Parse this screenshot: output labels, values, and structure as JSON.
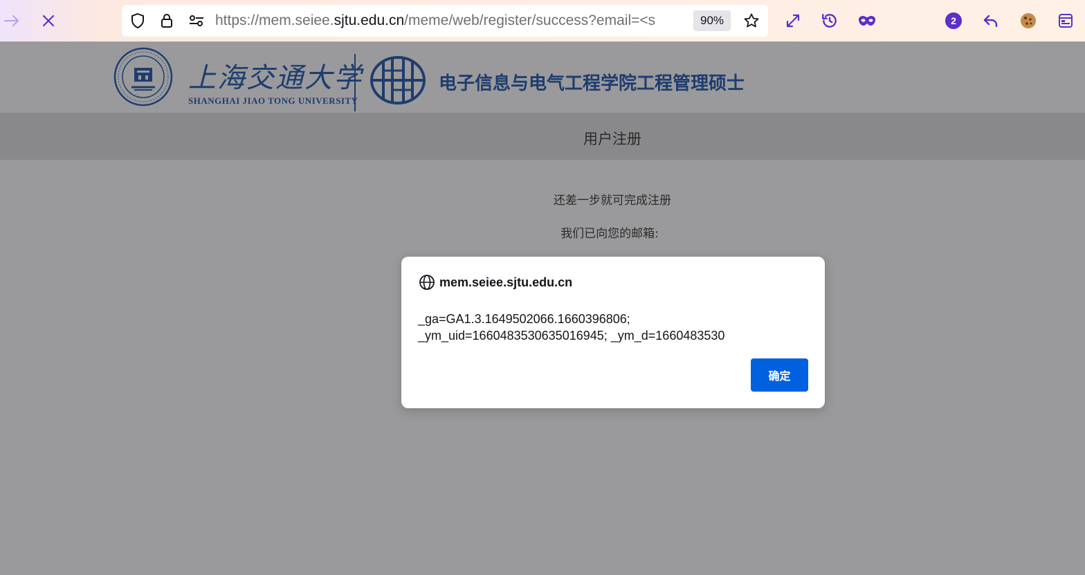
{
  "browser": {
    "url_host_prefix": "https://mem.seiee.",
    "url_host": "sjtu.edu.cn",
    "url_path": "/meme/web/register/success?email=<s",
    "zoom": "90%",
    "badge_count": "2",
    "colors": {
      "accent": "#5b2fc9",
      "nav_back": "#b79ff0"
    }
  },
  "header": {
    "sjtu_name_cn": "上海交通大学",
    "sjtu_name_en": "SHANGHAI JIAO TONG UNIVERSITY",
    "school_title": "电子信息与电气工程学院工程管理硕士"
  },
  "page": {
    "title": "用户注册",
    "line1": "还差一步就可完成注册",
    "line2": "我们已向您的邮箱:"
  },
  "dialog": {
    "host": "mem.seiee.sjtu.edu.cn",
    "message_line1": "_ga=GA1.3.1649502066.1660396806;",
    "message_line2": "_ym_uid=1660483530635016945; _ym_d=1660483530",
    "ok_label": "确定",
    "colors": {
      "button": "#0061e0"
    }
  }
}
